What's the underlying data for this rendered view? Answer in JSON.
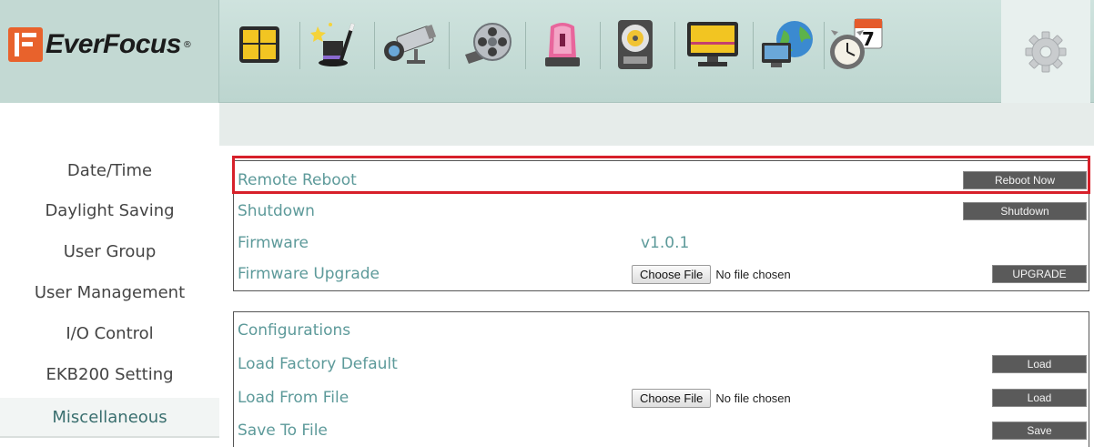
{
  "brand": {
    "name": "EverFocus",
    "reg_mark": "®"
  },
  "toolbar": {
    "icons": [
      "live-view-grid-icon",
      "magic-hat-wizard-icon",
      "camera-icon",
      "film-reel-icon",
      "alarm-siren-icon",
      "hard-disk-icon",
      "display-monitor-icon",
      "network-globe-icon",
      "schedule-clock-calendar-icon",
      "settings-gear-icon"
    ],
    "active_index": 9
  },
  "sidebar": {
    "items": [
      {
        "label": "Date/Time"
      },
      {
        "label": "Daylight Saving"
      },
      {
        "label": "User Group"
      },
      {
        "label": "User Management"
      },
      {
        "label": "I/O Control"
      },
      {
        "label": "EKB200 Setting"
      },
      {
        "label": "Miscellaneous"
      }
    ],
    "active_index": 6
  },
  "system_panel": {
    "remote_reboot": {
      "label": "Remote Reboot",
      "button": "Reboot Now"
    },
    "shutdown": {
      "label": "Shutdown",
      "button": "Shutdown"
    },
    "firmware": {
      "label": "Firmware",
      "value": "v1.0.1"
    },
    "firmware_upgrade": {
      "label": "Firmware Upgrade",
      "choose_file": "Choose File",
      "file_status": "No file chosen",
      "button": "UPGRADE"
    }
  },
  "config_panel": {
    "title": "Configurations",
    "load_factory": {
      "label": "Load Factory Default",
      "button": "Load"
    },
    "load_from_file": {
      "label": "Load From File",
      "choose_file": "Choose File",
      "file_status": "No file chosen",
      "button": "Load"
    },
    "save_to_file": {
      "label": "Save To File",
      "button": "Save"
    }
  },
  "colors": {
    "header_bg": "#c3d9d3",
    "label_teal": "#5d9a9a",
    "button_gray": "#5a5a5a",
    "highlight_red": "#d7202a",
    "logo_orange": "#e8622c"
  }
}
